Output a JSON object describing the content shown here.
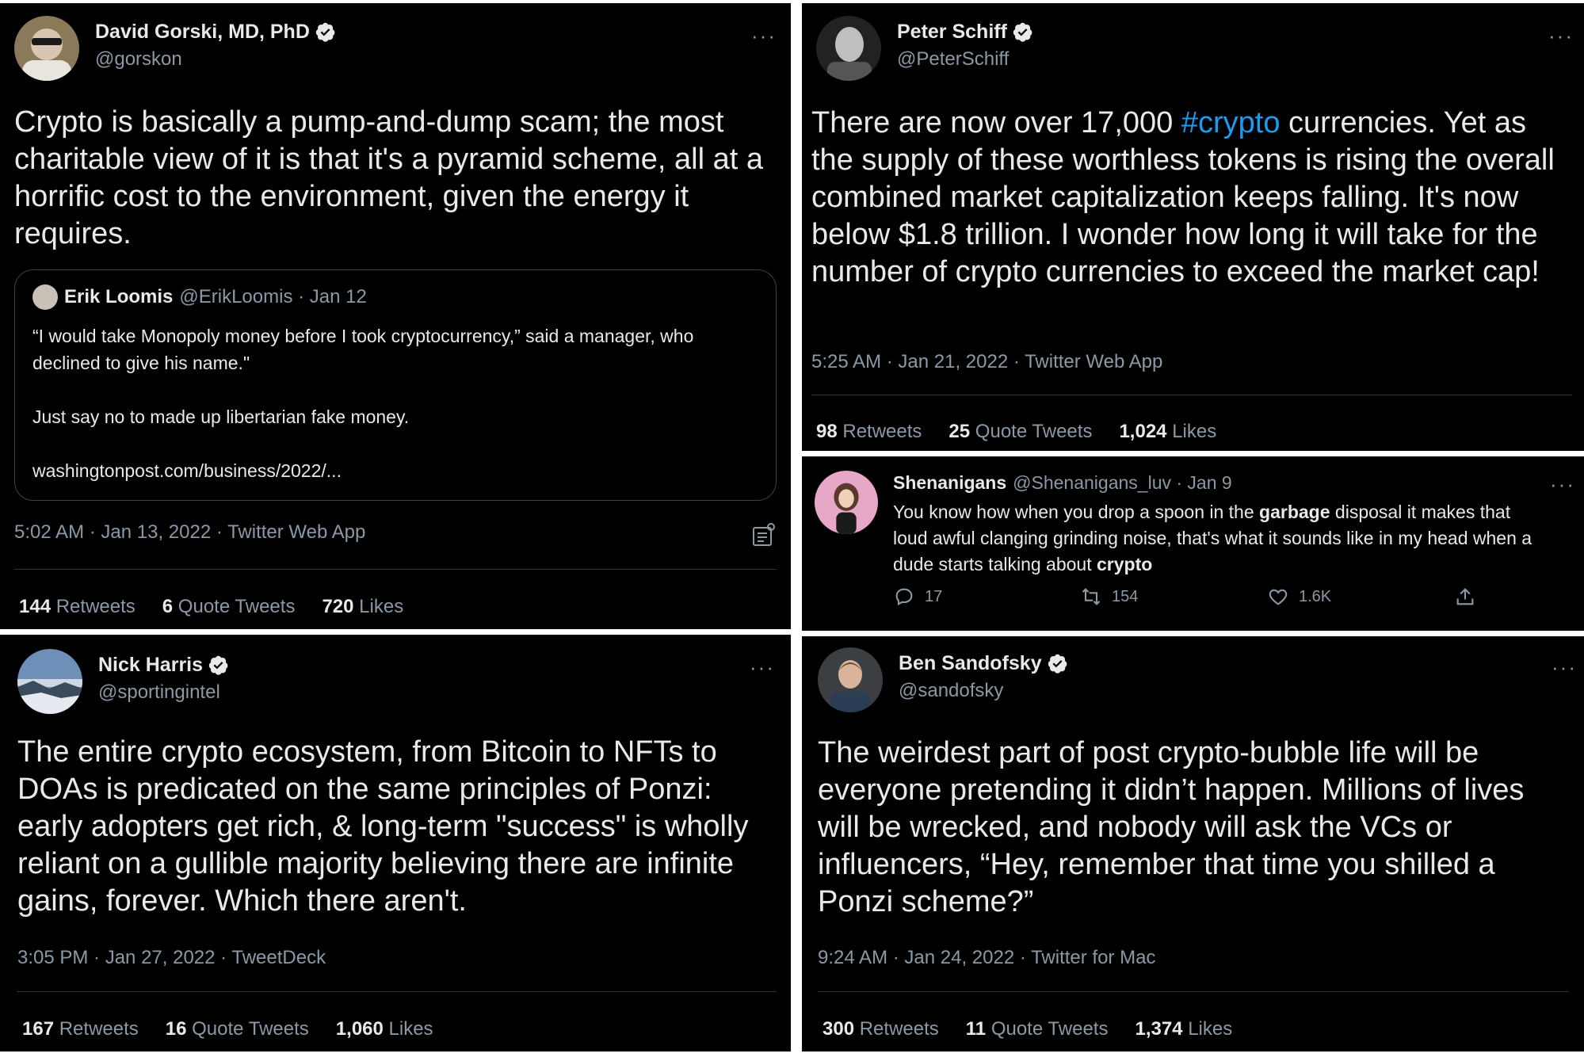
{
  "tweets": {
    "gorski": {
      "name": "David Gorski, MD, PhD",
      "handle": "@gorskon",
      "text": "Crypto is basically a pump-and-dump scam; the most charitable view of it is that it's a pyramid scheme, all at a horrific cost to the environment, given the energy it requires.",
      "quote": {
        "name": "Erik Loomis",
        "handle_date": "@ErikLoomis · Jan 12",
        "line1": "“I would take Monopoly money before I took cryptocurrency,” said a manager, who declined to give his name.\"",
        "line2": "Just say no to made up libertarian fake money.",
        "link": "washingtonpost.com/business/2022/..."
      },
      "meta": "5:02 AM · Jan 13, 2022 · Twitter Web App",
      "stats": [
        {
          "num": "144",
          "label": "Retweets"
        },
        {
          "num": "6",
          "label": "Quote Tweets"
        },
        {
          "num": "720",
          "label": "Likes"
        }
      ]
    },
    "schiff": {
      "name": "Peter Schiff",
      "handle": "@PeterSchiff",
      "text_before": "There are now over 17,000 ",
      "hashtag": "#crypto",
      "text_after": " currencies. Yet as the supply of these worthless tokens is rising the overall combined market capitalization keeps falling. It's now below $1.8 trillion. I wonder how long it will take for the number of crypto currencies to exceed the market cap!",
      "meta": "5:25 AM · Jan 21, 2022 · Twitter Web App",
      "stats": [
        {
          "num": "98",
          "label": "Retweets"
        },
        {
          "num": "25",
          "label": "Quote Tweets"
        },
        {
          "num": "1,024",
          "label": "Likes"
        }
      ]
    },
    "shenanigans": {
      "name": "Shenanigans",
      "handle_date": "@Shenanigans_luv · Jan 9",
      "text_1": "You know how when you drop a spoon in the ",
      "bold_1": "garbage",
      "text_2": " disposal it makes that loud awful clanging grinding noise, that's what it sounds like in my head when a dude starts talking about ",
      "bold_2": "crypto",
      "replies": "17",
      "retweets": "154",
      "likes": "1.6K"
    },
    "harris": {
      "name": "Nick Harris",
      "handle": "@sportingintel",
      "text": "The entire crypto ecosystem, from Bitcoin to NFTs to DOAs is predicated on the same principles of Ponzi: early adopters get rich, & long-term \"success\" is wholly reliant on a gullible majority believing there are infinite gains, forever. Which there aren't.",
      "meta": "3:05 PM · Jan 27, 2022 · TweetDeck",
      "stats": [
        {
          "num": "167",
          "label": "Retweets"
        },
        {
          "num": "16",
          "label": "Quote Tweets"
        },
        {
          "num": "1,060",
          "label": "Likes"
        }
      ]
    },
    "sandofsky": {
      "name": "Ben Sandofsky",
      "handle": "@sandofsky",
      "text": "The weirdest part of post crypto-bubble life will be everyone pretending it didn’t happen. Millions of lives will be wrecked, and nobody will ask the VCs or influencers, “Hey, remember that time you shilled a Ponzi scheme?”",
      "meta": "9:24 AM · Jan 24, 2022 · Twitter for Mac",
      "stats": [
        {
          "num": "300",
          "label": "Retweets"
        },
        {
          "num": "11",
          "label": "Quote Tweets"
        },
        {
          "num": "1,374",
          "label": "Likes"
        }
      ]
    }
  },
  "more_glyph": "···",
  "colors": {
    "background": "#000000",
    "text": "#e7e9ea",
    "muted": "#8b98a5",
    "link": "#1d9bf0",
    "verified": "#e7e9ea"
  }
}
